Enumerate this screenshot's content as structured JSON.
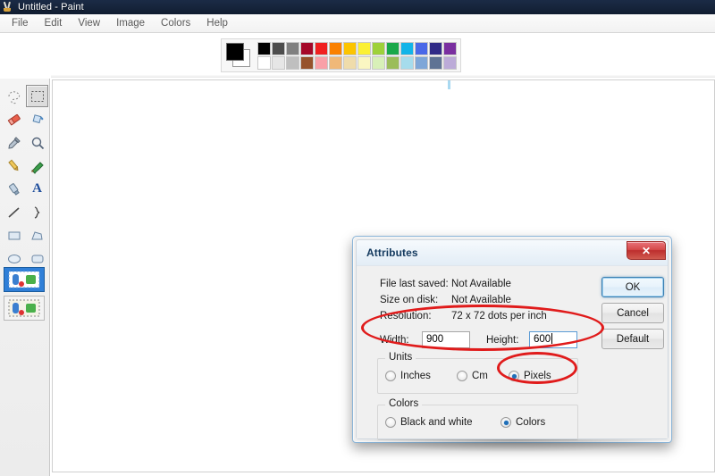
{
  "window": {
    "title": "Untitled - Paint",
    "icon": "paint-app-icon"
  },
  "menubar": {
    "items": [
      {
        "label": "File"
      },
      {
        "label": "Edit"
      },
      {
        "label": "View"
      },
      {
        "label": "Image"
      },
      {
        "label": "Colors"
      },
      {
        "label": "Help"
      }
    ]
  },
  "toolbox": {
    "tools": [
      {
        "name": "free-form-select",
        "glyph": "free-form-select-icon",
        "selected": false
      },
      {
        "name": "rectangular-select",
        "glyph": "rectangular-select-icon",
        "selected": true
      },
      {
        "name": "eraser",
        "glyph": "eraser-icon",
        "selected": false
      },
      {
        "name": "fill-with-color",
        "glyph": "paint-bucket-icon",
        "selected": false
      },
      {
        "name": "pick-color",
        "glyph": "eyedropper-icon",
        "selected": false
      },
      {
        "name": "magnifier",
        "glyph": "magnifier-icon",
        "selected": false
      },
      {
        "name": "pencil",
        "glyph": "pencil-icon",
        "selected": false
      },
      {
        "name": "brush",
        "glyph": "brush-icon",
        "selected": false
      },
      {
        "name": "airbrush",
        "glyph": "airbrush-icon",
        "selected": false
      },
      {
        "name": "text",
        "glyph": "text-tool-icon",
        "selected": false
      },
      {
        "name": "line",
        "glyph": "line-icon",
        "selected": false
      },
      {
        "name": "curve",
        "glyph": "curve-icon",
        "selected": false
      },
      {
        "name": "rectangle",
        "glyph": "rectangle-icon",
        "selected": false
      },
      {
        "name": "polygon",
        "glyph": "polygon-icon",
        "selected": false
      },
      {
        "name": "ellipse",
        "glyph": "ellipse-icon",
        "selected": false
      },
      {
        "name": "rounded-rectangle",
        "glyph": "rounded-rectangle-icon",
        "selected": false
      }
    ],
    "options": [
      {
        "name": "opaque-selection",
        "active": true
      },
      {
        "name": "transparent-selection",
        "active": false
      }
    ]
  },
  "palette": {
    "foreground_color": "#000000",
    "background_color": "#ffffff",
    "row1": [
      "#000000",
      "#4d4d4d",
      "#808080",
      "#a50829",
      "#f02020",
      "#fa8000",
      "#fcc400",
      "#fbf034",
      "#9ed13a",
      "#1aa84a",
      "#12b4e8",
      "#4a68e8",
      "#312b87",
      "#7a2fa0"
    ],
    "row2": [
      "#ffffff",
      "#e6e6e6",
      "#bfbfbf",
      "#96522c",
      "#f9a0a8",
      "#f0b878",
      "#efdcab",
      "#faf6c2",
      "#d8f0b8",
      "#9bbd5a",
      "#a6dcec",
      "#7ea6d8",
      "#5f7394",
      "#bcabd8"
    ]
  },
  "dialog": {
    "title": "Attributes",
    "close_label": "✕",
    "info_rows": [
      {
        "label": "File last saved:",
        "value": "Not Available"
      },
      {
        "label": "Size on disk:",
        "value": "Not Available"
      },
      {
        "label": "Resolution:",
        "value": "72 x 72 dots per inch"
      }
    ],
    "width_label": "Width:",
    "width_value": "900",
    "height_label": "Height:",
    "height_value": "600",
    "units": {
      "legend": "Units",
      "options": [
        {
          "label": "Inches",
          "selected": false
        },
        {
          "label": "Cm",
          "selected": false
        },
        {
          "label": "Pixels",
          "selected": true
        }
      ]
    },
    "colors": {
      "legend": "Colors",
      "options": [
        {
          "label": "Black and white",
          "selected": false
        },
        {
          "label": "Colors",
          "selected": true
        }
      ]
    },
    "buttons": [
      {
        "label": "OK",
        "focused": true
      },
      {
        "label": "Cancel",
        "focused": false
      },
      {
        "label": "Default",
        "focused": false
      }
    ]
  },
  "annotations": {
    "color": "#e01b1b",
    "shapes": [
      {
        "name": "width-height-highlight",
        "kind": "ellipse"
      },
      {
        "name": "pixels-option-highlight",
        "kind": "ellipse"
      }
    ]
  }
}
